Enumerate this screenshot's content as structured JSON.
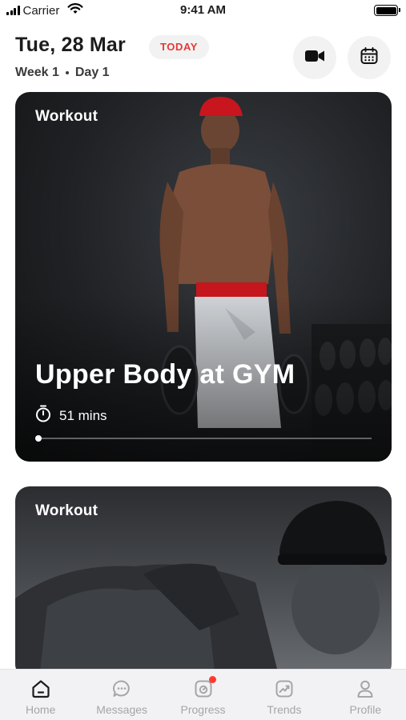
{
  "status_bar": {
    "carrier": "Carrier",
    "time": "9:41 AM"
  },
  "header": {
    "date": "Tue, 28 Mar",
    "today_badge": "TODAY",
    "week": "Week 1",
    "day": "Day 1",
    "video_icon": "video-camera-icon",
    "calendar_icon": "calendar-icon"
  },
  "cards": [
    {
      "tag": "Workout",
      "title": "Upper Body at GYM",
      "duration": "51 mins",
      "progress": 0.01
    },
    {
      "tag": "Workout"
    }
  ],
  "tabbar": {
    "items": [
      {
        "label": "Home",
        "icon": "home-icon",
        "active": true
      },
      {
        "label": "Messages",
        "icon": "chat-bubble-icon",
        "active": false
      },
      {
        "label": "Progress",
        "icon": "progress-icon",
        "active": false,
        "has_badge": true
      },
      {
        "label": "Trends",
        "icon": "trends-icon",
        "active": false
      },
      {
        "label": "Profile",
        "icon": "profile-icon",
        "active": false
      }
    ]
  },
  "colors": {
    "accent": "#e53935",
    "badge": "#ff3b30",
    "inactive": "#a5a5aa"
  }
}
